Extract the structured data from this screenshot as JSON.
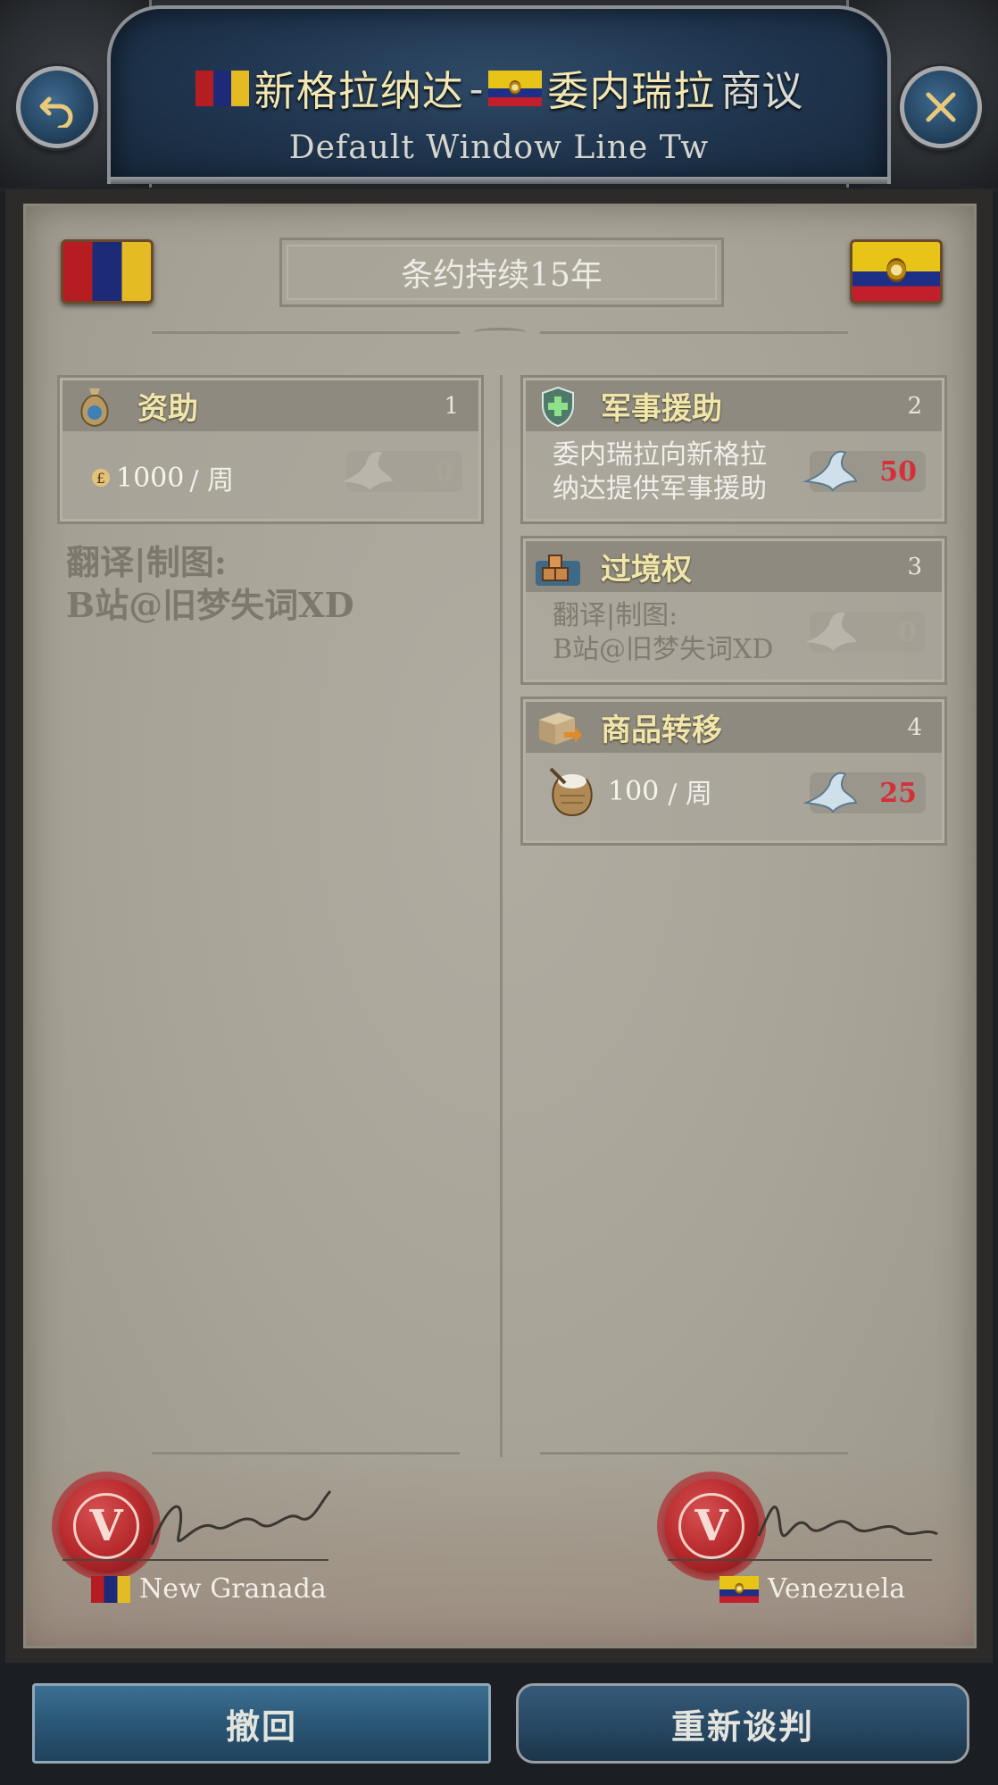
{
  "header": {
    "country_a": "新格拉纳达",
    "separator": "-",
    "country_b": "委内瑞拉",
    "suffix": "商议",
    "subtitle": "Default Window Line Tw",
    "back_icon": "undo-arrow-icon",
    "close_icon": "close-x-icon"
  },
  "treaty": {
    "duration": "条约持续15年"
  },
  "left_column": {
    "cards": [
      {
        "title": "资助",
        "number": "1",
        "icon": "money-bag-icon",
        "currency_icon": "pound-icon",
        "amount": "1000",
        "unit": "/ 周",
        "opinion": "0"
      }
    ],
    "watermark_line1": "翻译|制图:",
    "watermark_line2": "B站@旧梦失词XD"
  },
  "right_column": {
    "cards": [
      {
        "title": "军事援助",
        "number": "2",
        "icon": "military-aid-icon",
        "line1": "委内瑞拉向新格拉",
        "line2": "纳达提供军事援助",
        "opinion": "50"
      },
      {
        "title": "过境权",
        "number": "3",
        "icon": "transit-rights-icon",
        "line1": "翻译|制图:",
        "line2": "B站@旧梦失词XD",
        "opinion": "0"
      },
      {
        "title": "商品转移",
        "number": "4",
        "icon": "goods-transfer-icon",
        "goods_icon": "grain-sack-icon",
        "amount": "100",
        "unit": "/ 周",
        "opinion": "25"
      }
    ]
  },
  "signatures": {
    "left_name": "New Granada",
    "right_name": "Venezuela",
    "seal_letter": "V"
  },
  "buttons": {
    "withdraw": "撤回",
    "renegotiate": "重新谈判"
  },
  "colors": {
    "title_gold": "#f2e7b2",
    "opinion_red": "#d3303a",
    "paper": "#aaa59a",
    "button_blue": "#2a5675"
  }
}
